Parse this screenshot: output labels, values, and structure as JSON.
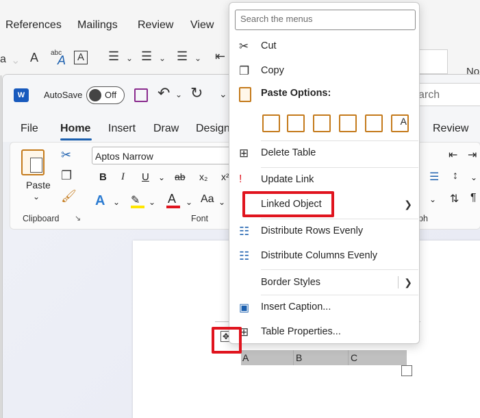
{
  "background_window": {
    "tabs": [
      "References",
      "Mailings",
      "Review",
      "View"
    ],
    "partial_text_right": "No"
  },
  "titlebar": {
    "autosave_label": "AutoSave",
    "autosave_state": "Off",
    "search_partial": "arch"
  },
  "ribbon": {
    "tabs": [
      "File",
      "Home",
      "Insert",
      "Draw",
      "Design",
      "Review"
    ],
    "font_name": "Aptos Narrow",
    "paste_label": "Paste",
    "clipboard_group": "Clipboard",
    "font_group": "Font",
    "paragraph_group_partial": "ph"
  },
  "table": {
    "headers": [
      "A",
      "B",
      "C"
    ]
  },
  "context_menu": {
    "search_placeholder": "Search the menus",
    "items": [
      {
        "label": "Cut",
        "icon": "scissors-icon"
      },
      {
        "label": "Copy",
        "icon": "copy-icon"
      },
      {
        "label": "Paste Options:",
        "icon": "clipboard-icon"
      },
      {
        "label": "Delete Table",
        "icon": "delete-table-icon"
      },
      {
        "label": "Update Link",
        "icon": "update-link-icon"
      },
      {
        "label": "Linked  Object",
        "icon": "",
        "submenu": true
      },
      {
        "label": "Distribute Rows Evenly",
        "icon": "distribute-rows-icon"
      },
      {
        "label": "Distribute Columns Evenly",
        "icon": "distribute-columns-icon"
      },
      {
        "label": "Border Styles",
        "icon": "",
        "submenu": true
      },
      {
        "label": "Insert Caption...",
        "icon": "insert-caption-icon"
      },
      {
        "label": "Table Properties...",
        "icon": "table-properties-icon"
      }
    ]
  },
  "colors": {
    "accent": "#1b5fae",
    "highlight_box": "#e0141e",
    "menu_bg": "#ffffff",
    "paste_icon_orange": "#c47a1b"
  }
}
